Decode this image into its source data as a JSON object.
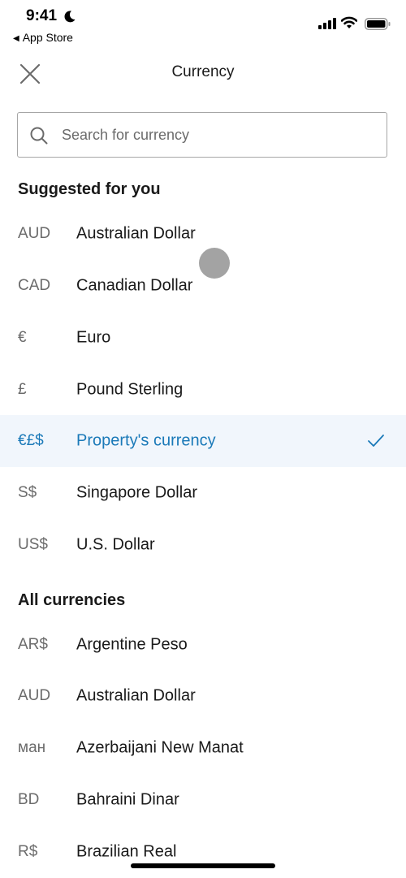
{
  "status_bar": {
    "time": "9:41",
    "back_app": "App Store",
    "icons": [
      "moon-icon",
      "signal-icon",
      "wifi-icon",
      "battery-icon"
    ]
  },
  "nav": {
    "title": "Currency",
    "close_icon": "close-icon"
  },
  "search": {
    "placeholder": "Search for currency",
    "value": ""
  },
  "suggested": {
    "title": "Suggested for you",
    "items": [
      {
        "symbol": "AUD",
        "name": "Australian Dollar",
        "selected": false
      },
      {
        "symbol": "CAD",
        "name": "Canadian Dollar",
        "selected": false
      },
      {
        "symbol": "€",
        "name": "Euro",
        "selected": false
      },
      {
        "symbol": "£",
        "name": "Pound Sterling",
        "selected": false
      },
      {
        "symbol": "€£$",
        "name": "Property's currency",
        "selected": true
      },
      {
        "symbol": "S$",
        "name": "Singapore Dollar",
        "selected": false
      },
      {
        "symbol": "US$",
        "name": "U.S. Dollar",
        "selected": false
      }
    ]
  },
  "all": {
    "title": "All currencies",
    "items": [
      {
        "symbol": "AR$",
        "name": "Argentine Peso"
      },
      {
        "symbol": "AUD",
        "name": "Australian Dollar"
      },
      {
        "symbol": "ман",
        "name": "Azerbaijani New Manat"
      },
      {
        "symbol": "BD",
        "name": "Bahraini Dinar"
      },
      {
        "symbol": "R$",
        "name": "Brazilian Real"
      }
    ]
  },
  "colors": {
    "accent": "#1a79b8",
    "selected_bg": "#f1f6fc",
    "secondary_text": "#6b6b6b",
    "primary_text": "#1a1a1a"
  }
}
